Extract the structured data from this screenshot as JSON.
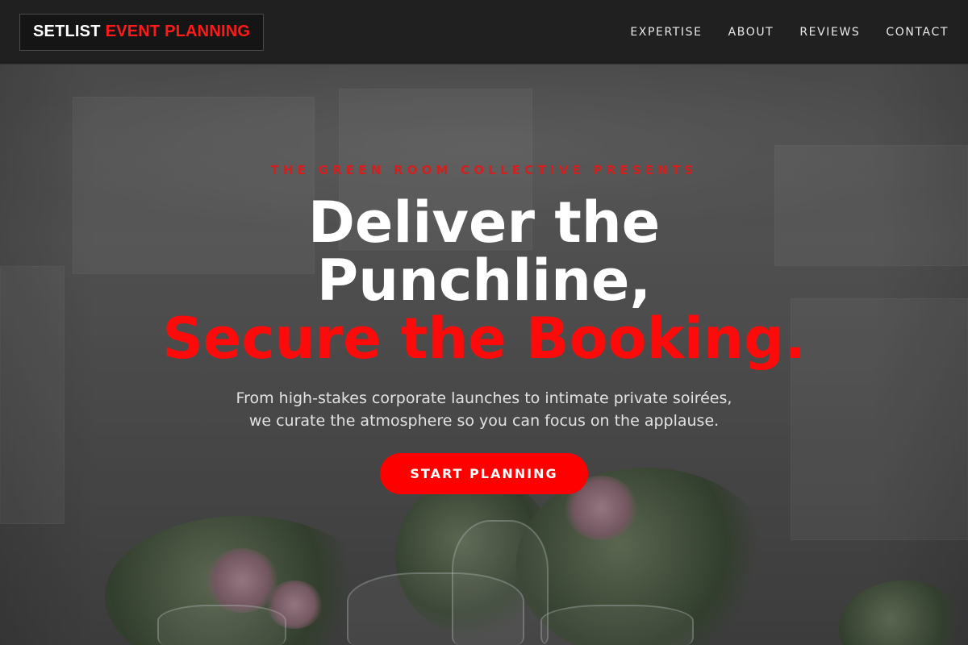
{
  "brand": {
    "name_white": "SETLIST",
    "name_red": "EVENT PLANNING"
  },
  "nav": {
    "items": [
      {
        "label": "EXPERTISE"
      },
      {
        "label": "ABOUT"
      },
      {
        "label": "REVIEWS"
      },
      {
        "label": "CONTACT"
      }
    ]
  },
  "hero": {
    "eyebrow": "THE GREEN ROOM COLLECTIVE PRESENTS",
    "headline_line1": "Deliver the",
    "headline_line2": "Punchline,",
    "headline_accent": "Secure the Booking.",
    "subtitle_line1": "From high-stakes corporate launches to intimate private soirées,",
    "subtitle_line2": "we curate the atmosphere so you can focus on the applause.",
    "cta_label": "START PLANNING",
    "background_image": "event-tent-table-flowers-glasses"
  },
  "colors": {
    "accent": "#ff0000",
    "header_bg": "#202020",
    "text": "#ffffff"
  }
}
